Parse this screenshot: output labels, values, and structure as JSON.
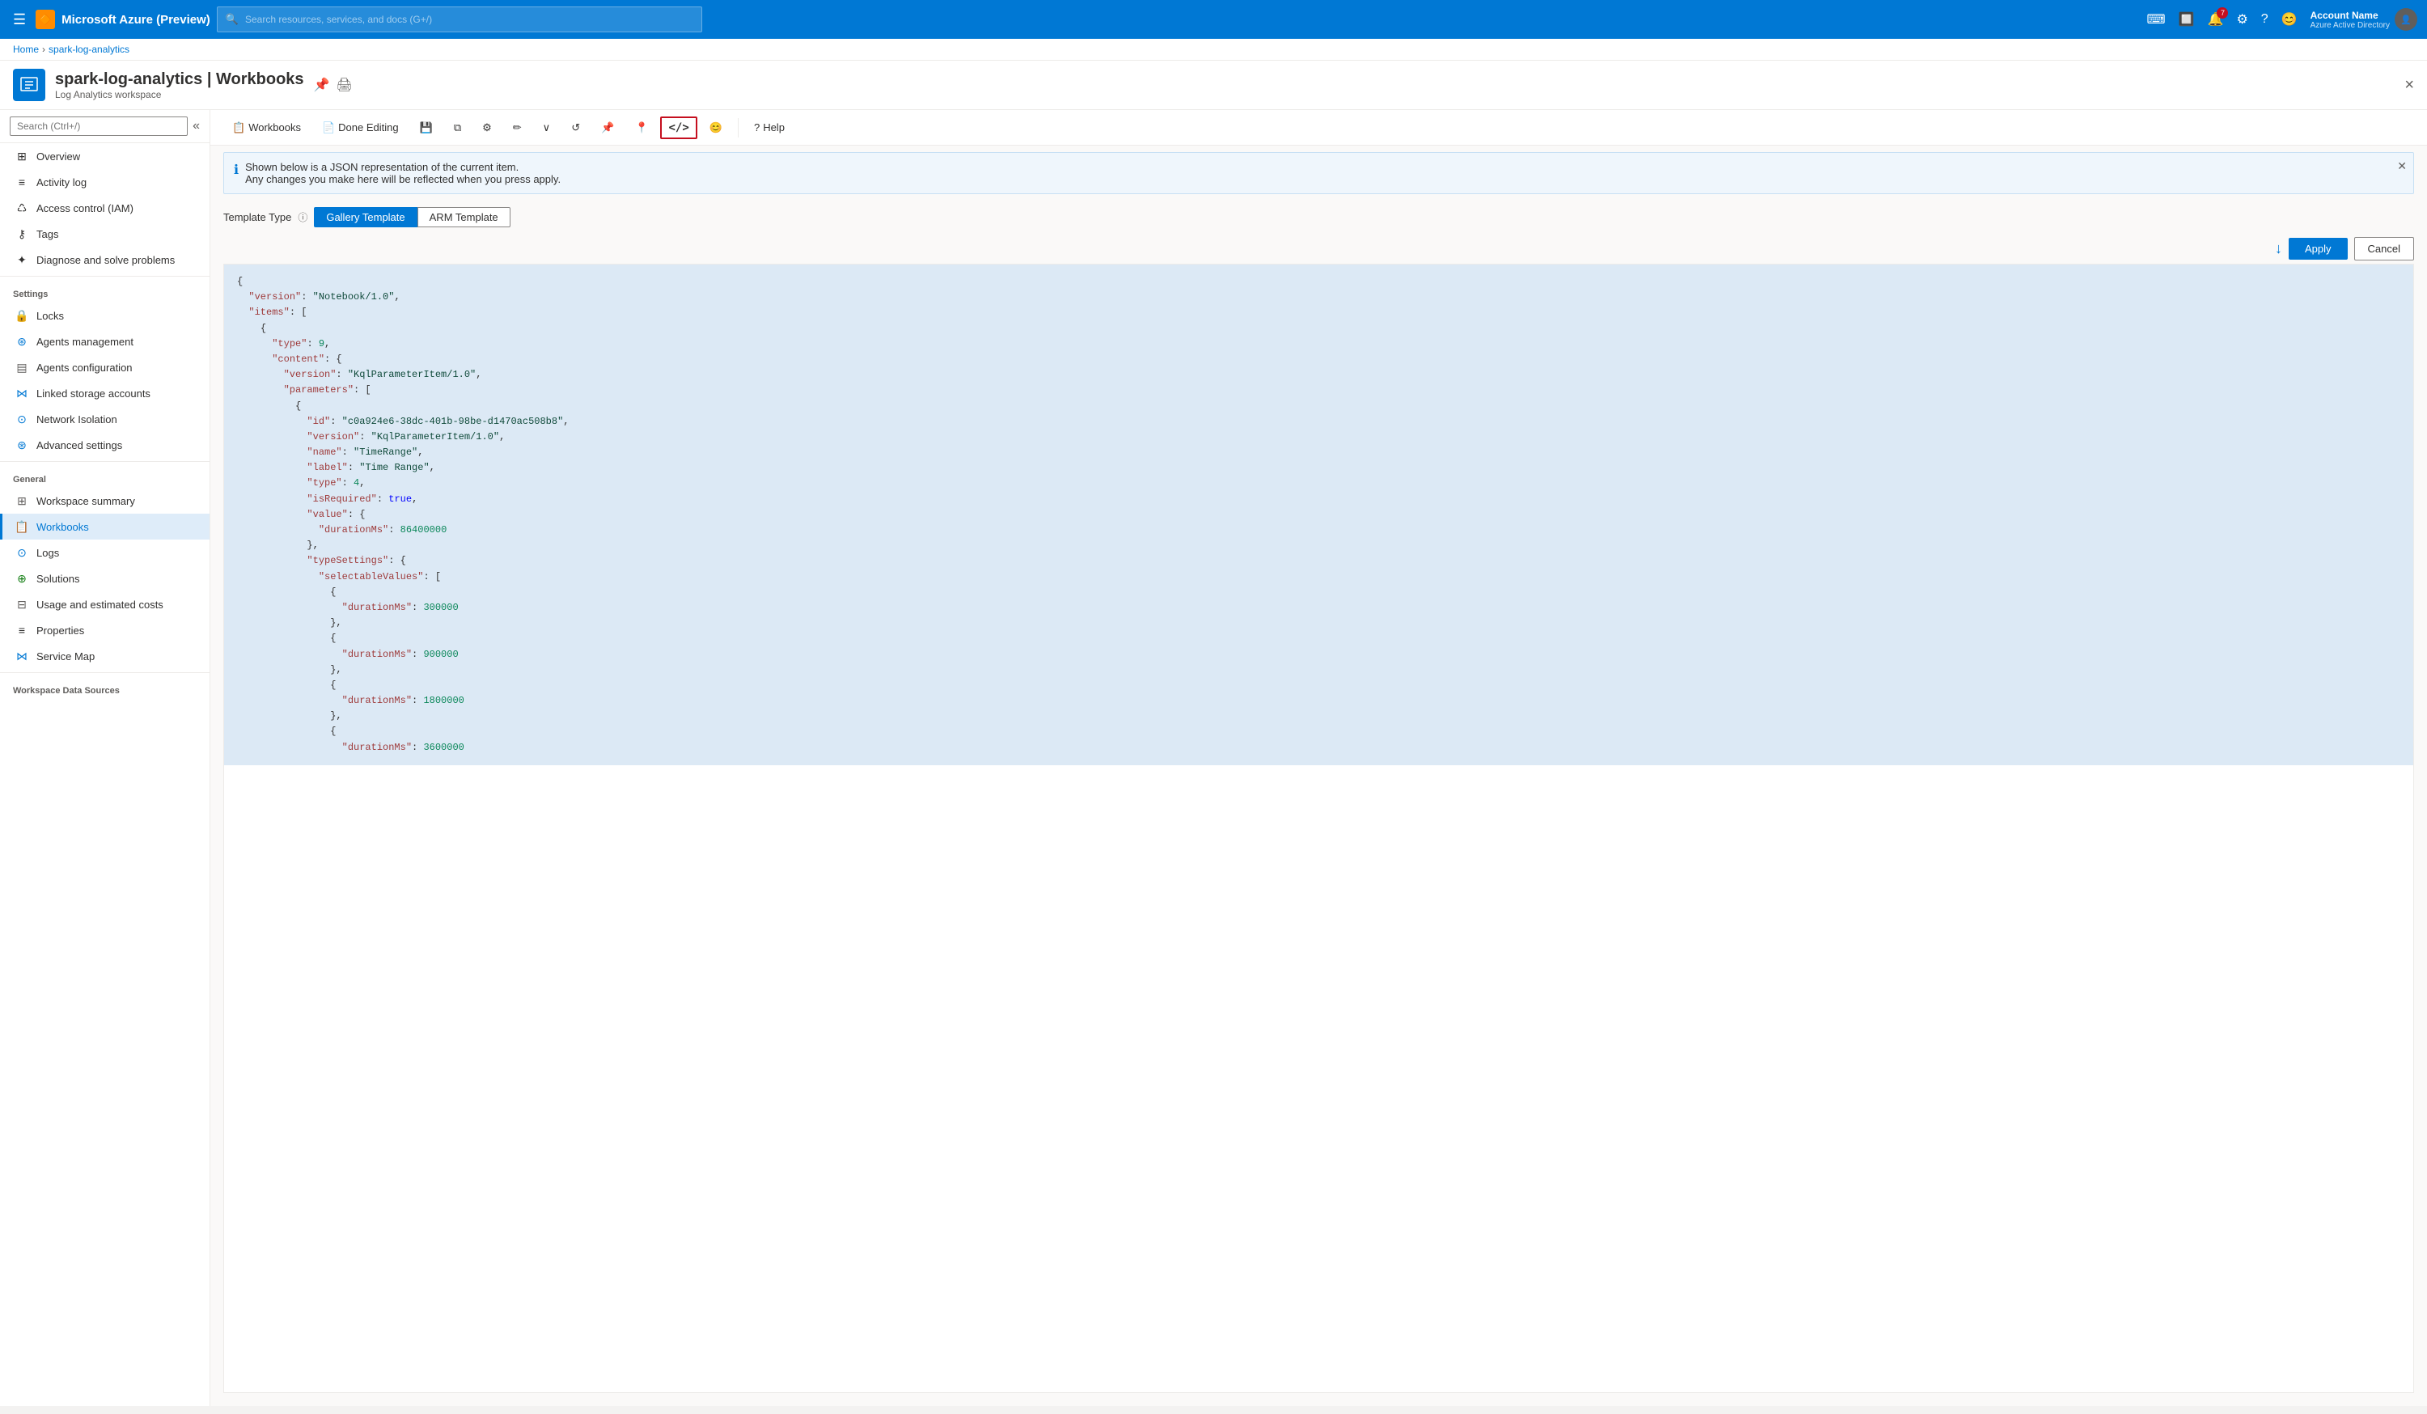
{
  "topbar": {
    "brand": "Microsoft Azure (Preview)",
    "search_placeholder": "Search resources, services, and docs (G+/)",
    "account_name": "Account Name",
    "account_sub": "Azure Active Directory",
    "notif_count": "7"
  },
  "breadcrumb": {
    "home": "Home",
    "resource": "spark-log-analytics"
  },
  "resource": {
    "title": "spark-log-analytics | Workbooks",
    "subtitle": "Log Analytics workspace",
    "close_label": "×"
  },
  "toolbar": {
    "workbooks_label": "Workbooks",
    "done_editing_label": "Done Editing",
    "help_label": "Help"
  },
  "info_panel": {
    "line1": "Shown below is a JSON representation of the current item.",
    "line2": "Any changes you make here will be reflected when you press apply."
  },
  "template_type": {
    "label": "Template Type",
    "options": [
      "Gallery Template",
      "ARM Template"
    ],
    "selected": "Gallery Template"
  },
  "actions": {
    "apply": "Apply",
    "cancel": "Cancel"
  },
  "sidebar": {
    "search_placeholder": "Search (Ctrl+/)",
    "items_top": [
      {
        "id": "overview",
        "label": "Overview",
        "icon": "⊞"
      },
      {
        "id": "activity-log",
        "label": "Activity log",
        "icon": "≡"
      },
      {
        "id": "access-control",
        "label": "Access control (IAM)",
        "icon": "♺"
      },
      {
        "id": "tags",
        "label": "Tags",
        "icon": "⚷"
      },
      {
        "id": "diagnose",
        "label": "Diagnose and solve problems",
        "icon": "✦"
      }
    ],
    "section_settings": "Settings",
    "items_settings": [
      {
        "id": "locks",
        "label": "Locks",
        "icon": "🔒"
      },
      {
        "id": "agents-management",
        "label": "Agents management",
        "icon": "⊛"
      },
      {
        "id": "agents-configuration",
        "label": "Agents configuration",
        "icon": "⊟"
      },
      {
        "id": "linked-storage",
        "label": "Linked storage accounts",
        "icon": "⋈"
      },
      {
        "id": "network-isolation",
        "label": "Network Isolation",
        "icon": "⊙"
      },
      {
        "id": "advanced-settings",
        "label": "Advanced settings",
        "icon": "⊛"
      }
    ],
    "section_general": "General",
    "items_general": [
      {
        "id": "workspace-summary",
        "label": "Workspace summary",
        "icon": "⊞"
      },
      {
        "id": "workbooks",
        "label": "Workbooks",
        "icon": "📋",
        "active": true
      },
      {
        "id": "logs",
        "label": "Logs",
        "icon": "⊙"
      },
      {
        "id": "solutions",
        "label": "Solutions",
        "icon": "⊕"
      },
      {
        "id": "usage-costs",
        "label": "Usage and estimated costs",
        "icon": "⊟"
      },
      {
        "id": "properties",
        "label": "Properties",
        "icon": "≡"
      },
      {
        "id": "service-map",
        "label": "Service Map",
        "icon": "⋈"
      }
    ],
    "section_workspace": "Workspace Data Sources"
  },
  "json_content": {
    "lines": [
      {
        "indent": 0,
        "content": "{"
      },
      {
        "indent": 1,
        "key": "\"version\"",
        "colon": ": ",
        "value": "\"Notebook/1.0\"",
        "comma": ","
      },
      {
        "indent": 1,
        "key": "\"items\"",
        "colon": ": [",
        "value": "",
        "comma": ""
      },
      {
        "indent": 2,
        "content": "{"
      },
      {
        "indent": 3,
        "key": "\"type\"",
        "colon": ": ",
        "value": "9",
        "comma": ","
      },
      {
        "indent": 3,
        "key": "\"content\"",
        "colon": ": {",
        "value": "",
        "comma": ""
      },
      {
        "indent": 4,
        "key": "\"version\"",
        "colon": ": ",
        "value": "\"KqlParameterItem/1.0\"",
        "comma": ","
      },
      {
        "indent": 4,
        "key": "\"parameters\"",
        "colon": ": [",
        "value": "",
        "comma": ""
      },
      {
        "indent": 5,
        "content": "{"
      },
      {
        "indent": 6,
        "key": "\"id\"",
        "colon": ": ",
        "value": "\"c0a924e6-38dc-401b-98be-d1470ac508b8\"",
        "comma": ","
      },
      {
        "indent": 6,
        "key": "\"version\"",
        "colon": ": ",
        "value": "\"KqlParameterItem/1.0\"",
        "comma": ","
      },
      {
        "indent": 6,
        "key": "\"name\"",
        "colon": ": ",
        "value": "\"TimeRange\"",
        "comma": ","
      },
      {
        "indent": 6,
        "key": "\"label\"",
        "colon": ": ",
        "value": "\"Time Range\"",
        "comma": ","
      },
      {
        "indent": 6,
        "key": "\"type\"",
        "colon": ": ",
        "value": "4",
        "comma": ","
      },
      {
        "indent": 6,
        "key": "\"isRequired\"",
        "colon": ": ",
        "value": "true",
        "comma": ","
      },
      {
        "indent": 6,
        "key": "\"value\"",
        "colon": ": {",
        "value": "",
        "comma": ""
      },
      {
        "indent": 7,
        "key": "\"durationMs\"",
        "colon": ": ",
        "value": "86400000",
        "comma": ""
      },
      {
        "indent": 6,
        "content": "},"
      },
      {
        "indent": 6,
        "key": "\"typeSettings\"",
        "colon": ": {",
        "value": "",
        "comma": ""
      },
      {
        "indent": 7,
        "key": "\"selectableValues\"",
        "colon": ": [",
        "value": "",
        "comma": ""
      },
      {
        "indent": 8,
        "content": "{"
      },
      {
        "indent": 9,
        "key": "\"durationMs\"",
        "colon": ": ",
        "value": "300000",
        "comma": ""
      },
      {
        "indent": 8,
        "content": "},"
      },
      {
        "indent": 8,
        "content": "{"
      },
      {
        "indent": 9,
        "key": "\"durationMs\"",
        "colon": ": ",
        "value": "900000",
        "comma": ""
      },
      {
        "indent": 8,
        "content": "},"
      },
      {
        "indent": 8,
        "content": "{"
      },
      {
        "indent": 9,
        "key": "\"durationMs\"",
        "colon": ": ",
        "value": "1800000",
        "comma": ""
      },
      {
        "indent": 8,
        "content": "},"
      },
      {
        "indent": 8,
        "content": "{"
      },
      {
        "indent": 9,
        "key": "\"durationMs\"",
        "colon": ": ",
        "value": "3600000",
        "comma": ""
      }
    ]
  }
}
